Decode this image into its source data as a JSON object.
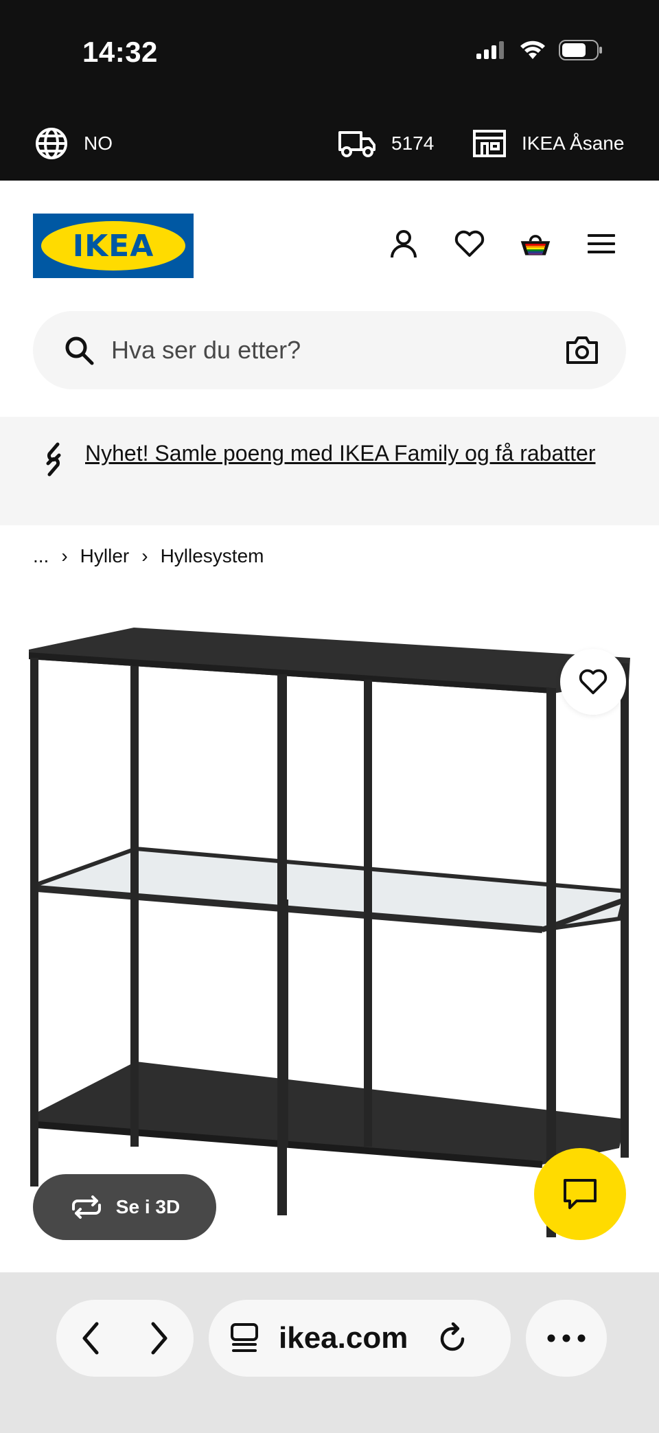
{
  "status": {
    "time": "14:32"
  },
  "info_bar": {
    "language": "NO",
    "postal_code": "5174",
    "store": "IKEA Åsane"
  },
  "header": {
    "logo_text": "IKEA",
    "search_placeholder": "Hva ser du etter?"
  },
  "promo": {
    "text": "Nyhet! Samle poeng med IKEA Family og få rabatter"
  },
  "breadcrumb": {
    "ellipsis": "...",
    "items": [
      "Hyller",
      "Hyllesystem"
    ]
  },
  "product": {
    "view_3d_label": "Se i 3D"
  },
  "browser": {
    "url": "ikea.com"
  },
  "colors": {
    "brand_blue": "#0058a3",
    "brand_yellow": "#ffdb00",
    "bar_dark": "#111111"
  },
  "icons": [
    "globe-icon",
    "truck-icon",
    "store-icon",
    "profile-icon",
    "heart-icon",
    "cart-icon",
    "menu-icon",
    "search-icon",
    "camera-icon",
    "link-icon",
    "rotate-3d-icon",
    "chat-icon",
    "back-icon",
    "forward-icon",
    "tabs-icon",
    "reload-icon",
    "more-icon"
  ]
}
